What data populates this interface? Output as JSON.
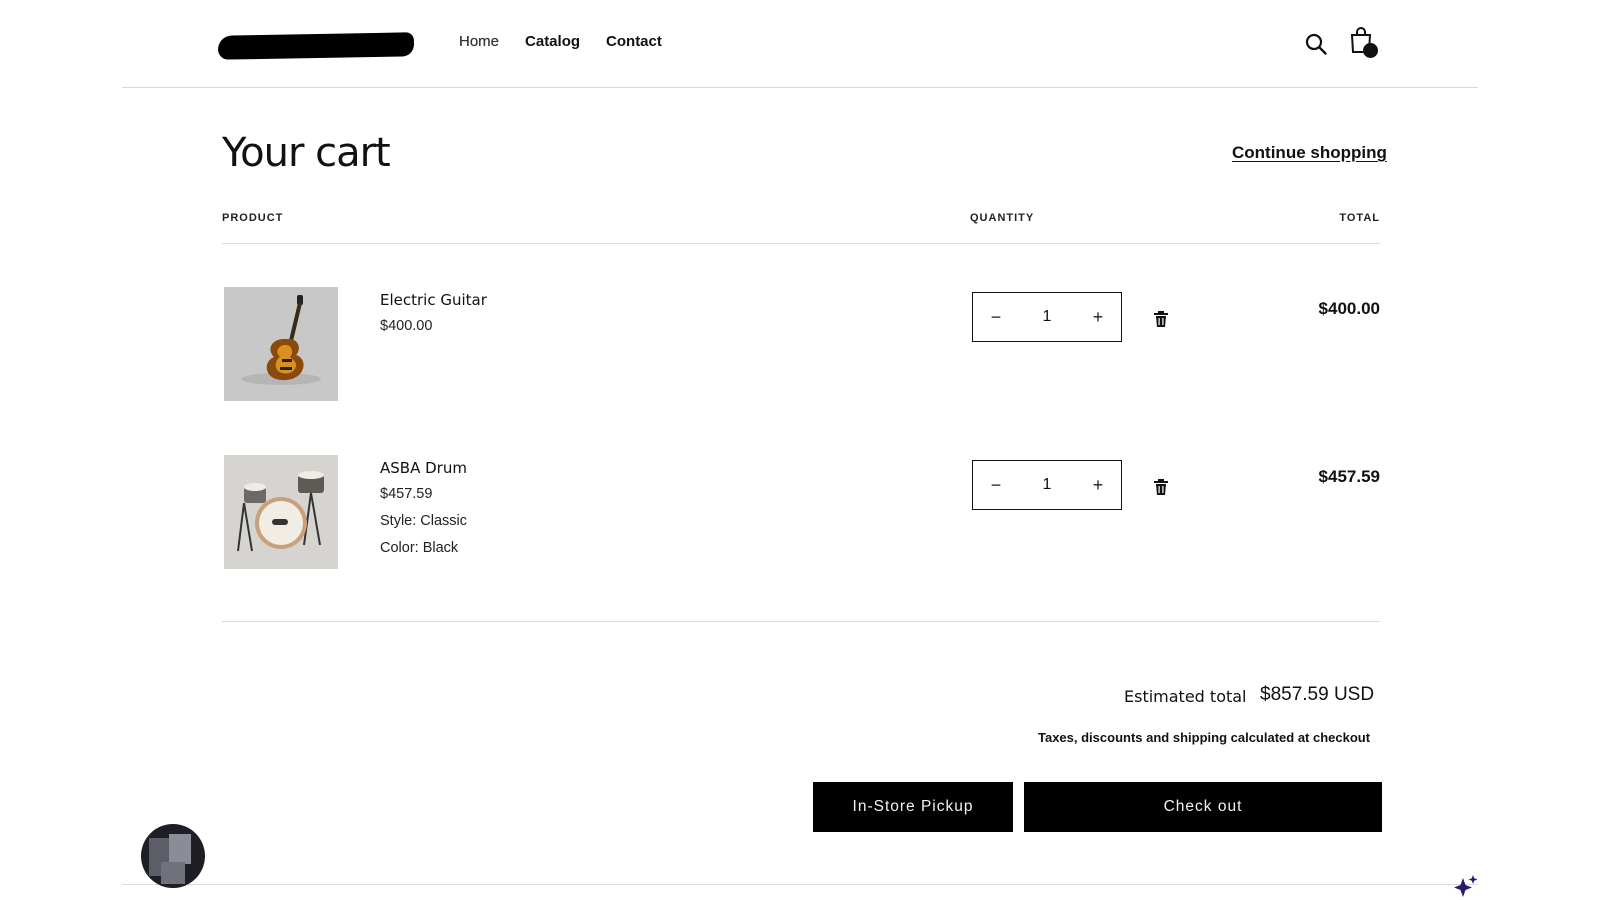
{
  "header": {
    "nav": [
      {
        "label": "Home"
      },
      {
        "label": "Catalog"
      },
      {
        "label": "Contact"
      }
    ]
  },
  "cart": {
    "title": "Your cart",
    "continue_label": "Continue shopping",
    "columns": {
      "product": "PRODUCT",
      "quantity": "QUANTITY",
      "total": "TOTAL"
    },
    "items": [
      {
        "name": "Electric Guitar",
        "price": "$400.00",
        "quantity": "1",
        "total": "$400.00",
        "minus": "−",
        "plus": "+"
      },
      {
        "name": "ASBA Drum",
        "price": "$457.59",
        "style": "Style: Classic",
        "color": "Color: Black",
        "quantity": "1",
        "total": "$457.59",
        "minus": "−",
        "plus": "+"
      }
    ],
    "estimated_label": "Estimated total",
    "estimated_value": "$857.59 USD",
    "tax_note": "Taxes, discounts and shipping calculated at checkout",
    "pickup_label": "In-Store Pickup",
    "checkout_label": "Check out"
  },
  "icons": {
    "search": "search-icon",
    "cart": "shopping-bag-icon",
    "trash": "trash-icon",
    "sparkle": "sparkle-icon"
  },
  "colors": {
    "button_bg": "#000000",
    "sparkle": "#2a1a6b"
  }
}
